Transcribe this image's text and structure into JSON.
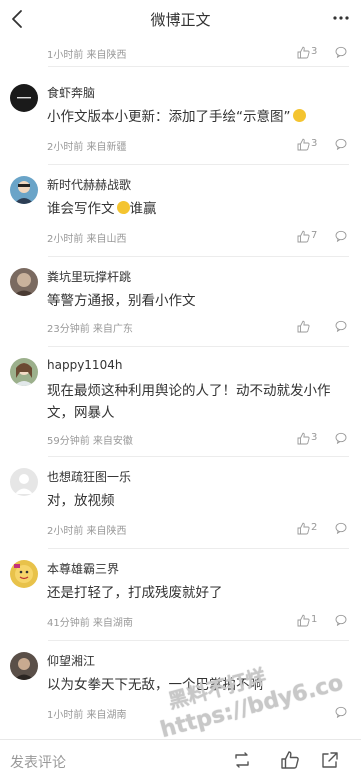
{
  "header": {
    "title": "微博正文"
  },
  "top_partial": {
    "meta": "1小时前 来自陕西",
    "likes": "3"
  },
  "comments": [
    {
      "name": "食虾奔脑",
      "text": "小作文版本小更新：添加了手绘“示意图”",
      "meta": "2小时前 来自新疆",
      "likes": "3",
      "avatar_color": "#1a1a1a"
    },
    {
      "name": "新时代赫赫战歌",
      "text": "谁会写作文",
      "text_tail": "谁赢",
      "meta": "2小时前 来自山西",
      "likes": "7",
      "avatar_color": "#6aa4c8"
    },
    {
      "name": "粪坑里玩撑杆跳",
      "text": "等警方通报，别看小作文",
      "meta": "23分钟前 来自广东",
      "likes": "",
      "avatar_color": "#7a6a60"
    },
    {
      "name": "happy1104h",
      "text": "现在最烦这种利用舆论的人了！动不动就发小作文，网暴人",
      "meta": "59分钟前 来自安徽",
      "likes": "3",
      "avatar_color": "#9cb08c"
    },
    {
      "name": "也想疏狂图一乐",
      "text": "对，放视频",
      "meta": "2小时前 来自陕西",
      "likes": "2",
      "avatar_color": "#e6e6e6"
    },
    {
      "name": "本尊雄霸三界",
      "text": "还是打轻了，打成残废就好了",
      "meta": "41分钟前 来自湖南",
      "likes": "1",
      "avatar_color": "#e8c24a"
    },
    {
      "name": "仰望湘江",
      "text": "以为女拳天下无敌，一个巴掌拍不响",
      "meta": "1小时前 来自湖南",
      "likes": "",
      "avatar_color": "#5a4f48"
    }
  ],
  "footer": {
    "input_placeholder": "发表评论"
  },
  "watermark": {
    "line1": "黑料不打烊",
    "line2": "https://bdy6.co"
  },
  "colors": {
    "meta_gray": "#999999",
    "text": "#333333",
    "separator": "#ececec"
  }
}
